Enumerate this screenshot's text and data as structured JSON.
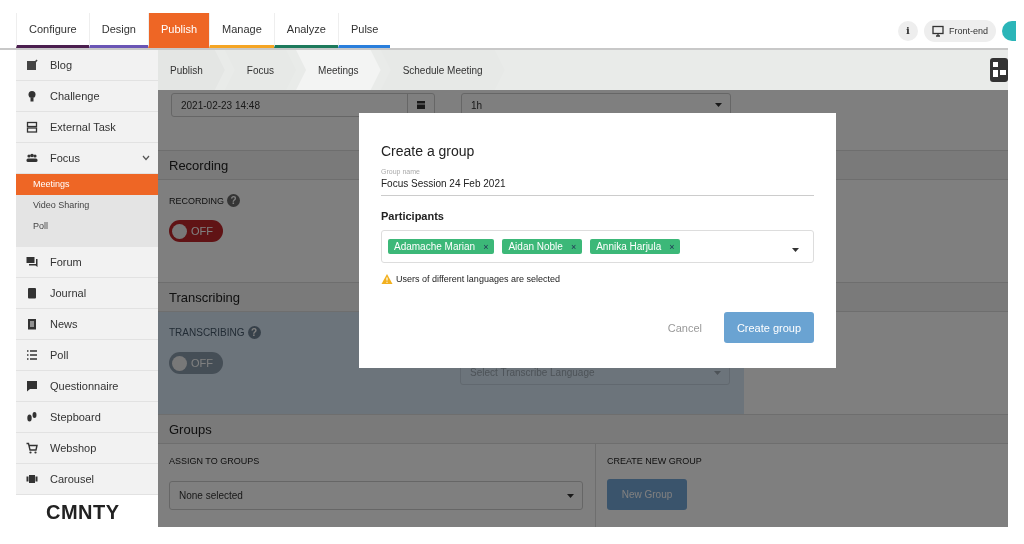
{
  "top_tabs": [
    {
      "label": "Configure",
      "selected": false,
      "color": "#4b1f4f"
    },
    {
      "label": "Design",
      "selected": false,
      "color": "#6a55b5"
    },
    {
      "label": "Publish",
      "selected": true,
      "color": "#ee6625"
    },
    {
      "label": "Manage",
      "selected": false,
      "color": "#f5a524"
    },
    {
      "label": "Analyze",
      "selected": false,
      "color": "#1d7a5c"
    },
    {
      "label": "Pulse",
      "selected": false,
      "color": "#2a7fdc"
    }
  ],
  "header_actions": {
    "info": "i",
    "frontend": "Front-end"
  },
  "sidebar": {
    "items": [
      {
        "label": "Blog"
      },
      {
        "label": "Challenge"
      },
      {
        "label": "External Task"
      },
      {
        "label": "Focus",
        "expanded": true,
        "children": [
          {
            "label": "Meetings",
            "selected": true
          },
          {
            "label": "Video Sharing",
            "selected": false
          },
          {
            "label": "Poll",
            "selected": false
          }
        ]
      },
      {
        "label": "Forum"
      },
      {
        "label": "Journal"
      },
      {
        "label": "News"
      },
      {
        "label": "Poll"
      },
      {
        "label": "Questionnaire"
      },
      {
        "label": "Stepboard"
      },
      {
        "label": "Webshop"
      },
      {
        "label": "Carousel"
      }
    ],
    "logo": "CMNTY"
  },
  "breadcrumb": [
    "Publish",
    "Focus",
    "Meetings",
    "Schedule Meeting"
  ],
  "schedule": {
    "date": "2021-02-23 14:48",
    "duration": "1h"
  },
  "recording": {
    "title": "Recording",
    "label": "RECORDING",
    "help": "?",
    "toggle": {
      "on": false,
      "text": "OFF",
      "disabled": false
    }
  },
  "transcribing": {
    "title": "Transcribing",
    "label": "TRANSCRIBING",
    "help": "?",
    "toggle": {
      "on": false,
      "text": "OFF",
      "disabled": true
    },
    "language_placeholder": "Select Transcribe Language"
  },
  "groups": {
    "title": "Groups",
    "assign_label": "ASSIGN TO GROUPS",
    "assign_value": "None selected",
    "create_label": "CREATE NEW GROUP",
    "new_group_button": "New Group"
  },
  "modal": {
    "title": "Create a group",
    "group_name_label": "Group name",
    "group_name_value": "Focus Session 24 Feb 2021",
    "participants_label": "Participants",
    "participants": [
      "Adamache Marian",
      "Aidan Noble",
      "Annika Harjula"
    ],
    "remove": "×",
    "warning": "Users of different languages are selected",
    "cancel": "Cancel",
    "create": "Create group"
  }
}
